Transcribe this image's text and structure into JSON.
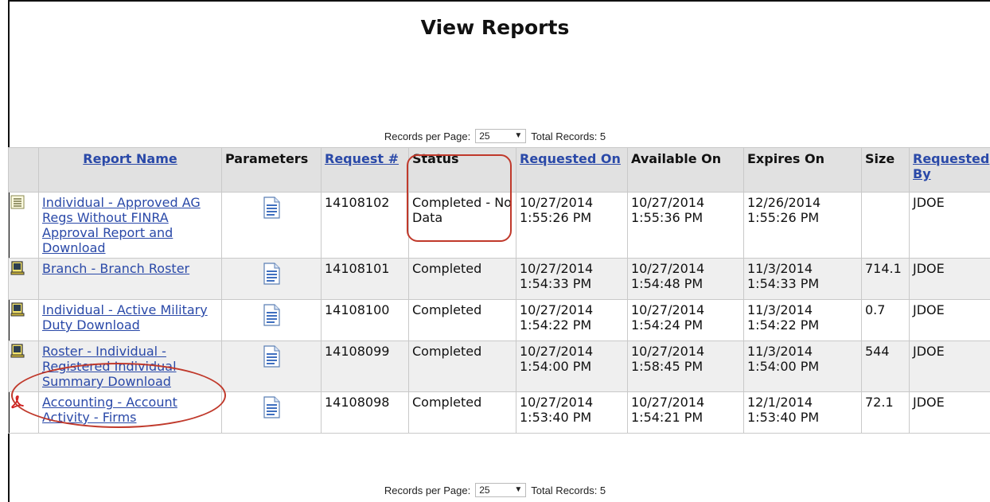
{
  "page": {
    "title": "View Reports"
  },
  "pager": {
    "records_label": "Records per Page:",
    "records_value": "25",
    "total_label": "Total Records: 5"
  },
  "table": {
    "headers": {
      "report_name": "Report Name",
      "parameters": "Parameters",
      "request_no": "Request #",
      "status": "Status",
      "requested_on": "Requested On",
      "available_on": "Available On",
      "expires_on": "Expires On",
      "size": "Size",
      "requested_by": "Requested By"
    },
    "rows": [
      {
        "icon": "list-document-icon",
        "name": "Individual - Approved AG Regs Without FINRA Approval Report and Download",
        "request": "14108102",
        "status": "Completed - No Data",
        "requested_on": "10/27/2014 1:55:26 PM",
        "available_on": "10/27/2014 1:55:36 PM",
        "expires_on": "12/26/2014 1:55:26 PM",
        "size": "",
        "by": "JDOE"
      },
      {
        "icon": "spreadsheet-icon",
        "name": "Branch - Branch Roster",
        "request": "14108101",
        "status": "Completed",
        "requested_on": "10/27/2014 1:54:33 PM",
        "available_on": "10/27/2014 1:54:48 PM",
        "expires_on": "11/3/2014 1:54:33 PM",
        "size": "714.1",
        "by": "JDOE"
      },
      {
        "icon": "spreadsheet-icon",
        "name": "Individual - Active Military Duty Download",
        "request": "14108100",
        "status": "Completed",
        "requested_on": "10/27/2014 1:54:22 PM",
        "available_on": "10/27/2014 1:54:24 PM",
        "expires_on": "11/3/2014 1:54:22 PM",
        "size": "0.7",
        "by": "JDOE"
      },
      {
        "icon": "spreadsheet-icon",
        "name": "Roster - Individual - Registered Individual Summary Download",
        "request": "14108099",
        "status": "Completed",
        "requested_on": "10/27/2014 1:54:00 PM",
        "available_on": "10/27/2014 1:58:45 PM",
        "expires_on": "11/3/2014 1:54:00 PM",
        "size": "544",
        "by": "JDOE"
      },
      {
        "icon": "pdf-icon",
        "name": "Accounting - Account Activity - Firms",
        "request": "14108098",
        "status": "Completed",
        "requested_on": "10/27/2014 1:53:40 PM",
        "available_on": "10/27/2014 1:54:21 PM",
        "expires_on": "12/1/2014 1:53:40 PM",
        "size": "72.1",
        "by": "JDOE"
      }
    ]
  },
  "colors": {
    "link": "#2a49a8",
    "header_bg": "#e1e1e1",
    "callout": "#c0392b"
  }
}
